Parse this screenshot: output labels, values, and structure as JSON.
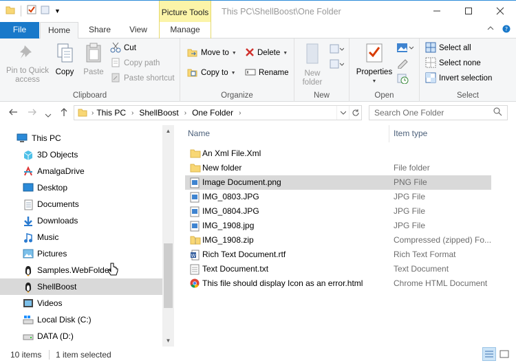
{
  "window": {
    "title": "This PC\\ShellBoost\\One Folder",
    "context_tab": "Picture Tools"
  },
  "tabs": {
    "file": "File",
    "home": "Home",
    "share": "Share",
    "view": "View",
    "manage": "Manage"
  },
  "ribbon": {
    "clipboard": {
      "label": "Clipboard",
      "pin_line1": "Pin to Quick",
      "pin_line2": "access",
      "copy": "Copy",
      "paste": "Paste",
      "cut": "Cut",
      "copy_path": "Copy path",
      "paste_shortcut": "Paste shortcut"
    },
    "organize": {
      "label": "Organize",
      "move_to": "Move to",
      "copy_to": "Copy to",
      "delete": "Delete",
      "rename": "Rename"
    },
    "new": {
      "label": "New",
      "new_folder_line1": "New",
      "new_folder_line2": "folder"
    },
    "open": {
      "label": "Open",
      "properties": "Properties"
    },
    "select": {
      "label": "Select",
      "select_all": "Select all",
      "select_none": "Select none",
      "invert_selection": "Invert selection"
    }
  },
  "address": {
    "crumbs": [
      "This PC",
      "ShellBoost",
      "One Folder"
    ],
    "search_placeholder": "Search One Folder"
  },
  "nav": {
    "root": "This PC",
    "items": [
      "3D Objects",
      "AmalgaDrive",
      "Desktop",
      "Documents",
      "Downloads",
      "Music",
      "Pictures",
      "Samples.WebFolder",
      "ShellBoost",
      "Videos",
      "Local Disk (C:)",
      "DATA (D:)"
    ]
  },
  "filelist": {
    "col_name": "Name",
    "col_type": "Item type",
    "rows": [
      {
        "name": "An Xml File.Xml",
        "type": ""
      },
      {
        "name": "New folder",
        "type": "File folder"
      },
      {
        "name": "Image Document.png",
        "type": "PNG File"
      },
      {
        "name": "IMG_0803.JPG",
        "type": "JPG File"
      },
      {
        "name": "IMG_0804.JPG",
        "type": "JPG File"
      },
      {
        "name": "IMG_1908.jpg",
        "type": "JPG File"
      },
      {
        "name": "IMG_1908.zip",
        "type": "Compressed (zipped) Fo..."
      },
      {
        "name": "Rich Text Document.rtf",
        "type": "Rich Text Format"
      },
      {
        "name": "Text Document.txt",
        "type": "Text Document"
      },
      {
        "name": "This file should display Icon as an error.html",
        "type": "Chrome HTML Document"
      }
    ]
  },
  "status": {
    "count": "10 items",
    "selected": "1 item selected"
  },
  "colors": {
    "file_tab": "#1979ca",
    "context_tab": "#fbf4a8",
    "selection": "#d9d9d9"
  }
}
